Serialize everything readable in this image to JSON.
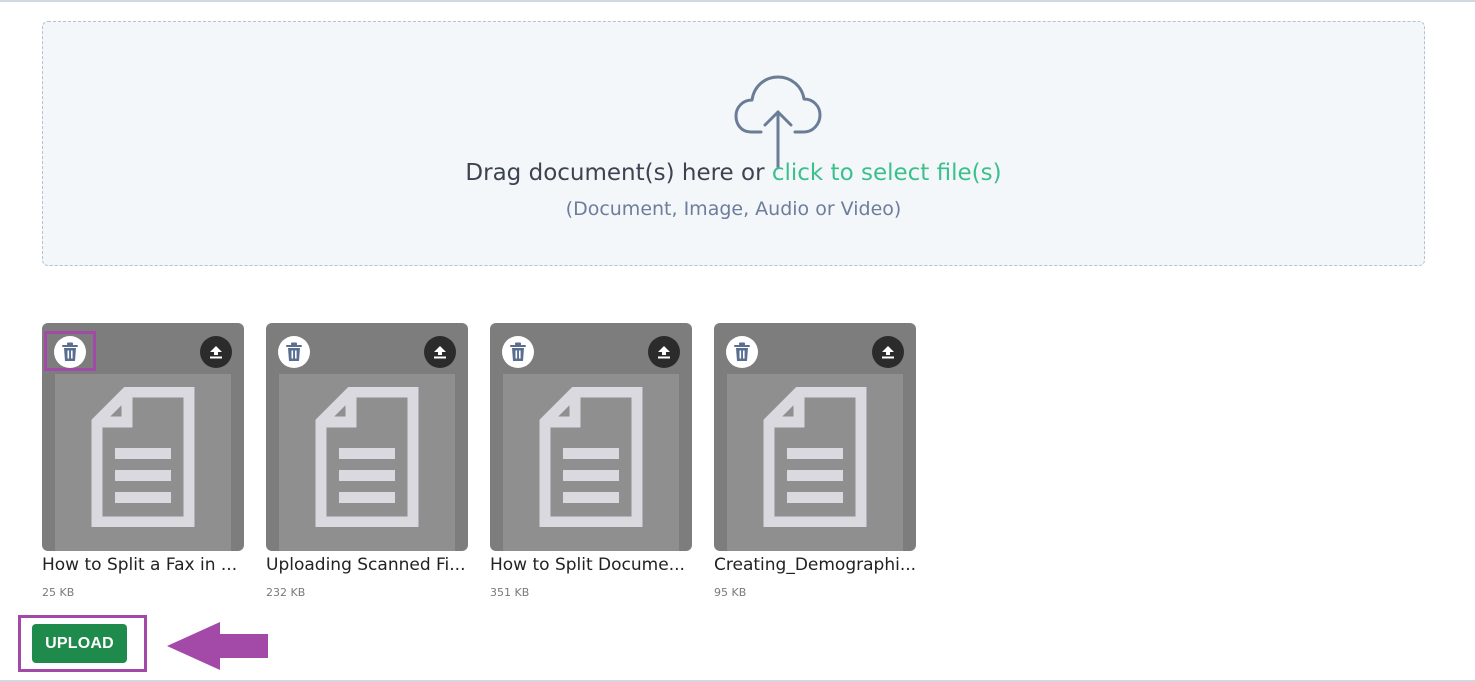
{
  "dropzone": {
    "prompt_prefix": "Drag document(s) here or ",
    "prompt_link": "click to select file(s)",
    "subtitle": "(Document, Image, Audio or Video)",
    "icon": "cloud-upload-icon"
  },
  "files": [
    {
      "name": "How to Split a Fax in ...",
      "size": "25 KB"
    },
    {
      "name": "Uploading Scanned Fi...",
      "size": "232 KB"
    },
    {
      "name": "How to Split Docume...",
      "size": "351 KB"
    },
    {
      "name": "Creating_Demographi...",
      "size": "95 KB"
    }
  ],
  "actions": {
    "upload_label": "UPLOAD"
  },
  "colors": {
    "link": "#3cc08b",
    "upload_button": "#1e8a4c",
    "highlight": "#a34aa8"
  }
}
